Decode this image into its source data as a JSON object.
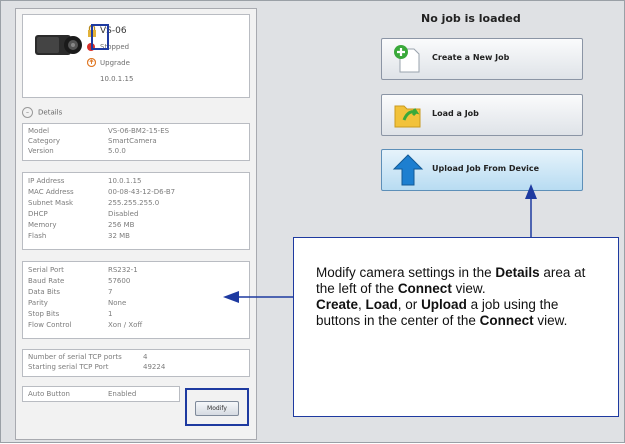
{
  "device": {
    "name": "VS-06",
    "status": "Stopped",
    "upgrade": "Upgrade",
    "ip": "10.0.1.15"
  },
  "details_header": "Details",
  "details": {
    "general": [
      {
        "k": "Model",
        "v": "VS-06-BM2-15-ES"
      },
      {
        "k": "Category",
        "v": "SmartCamera"
      },
      {
        "k": "Version",
        "v": "5.0.0"
      }
    ],
    "network": [
      {
        "k": "IP Address",
        "v": "10.0.1.15"
      },
      {
        "k": "MAC Address",
        "v": "00-08-43-12-D6-B7"
      },
      {
        "k": "Subnet Mask",
        "v": "255.255.255.0"
      },
      {
        "k": "DHCP",
        "v": "Disabled"
      },
      {
        "k": "Memory",
        "v": "256 MB"
      },
      {
        "k": "Flash",
        "v": "32 MB"
      }
    ],
    "serial": [
      {
        "k": "Serial Port",
        "v": "RS232-1"
      },
      {
        "k": "Baud Rate",
        "v": "57600"
      },
      {
        "k": "Data Bits",
        "v": "7"
      },
      {
        "k": "Parity",
        "v": "None"
      },
      {
        "k": "Stop Bits",
        "v": "1"
      },
      {
        "k": "Flow Control",
        "v": "Xon / Xoff"
      }
    ],
    "tcp": [
      {
        "k": "Number of serial TCP ports",
        "v": "4"
      },
      {
        "k": "Starting serial TCP Port",
        "v": "49224"
      }
    ],
    "auto": [
      {
        "k": "Auto Button",
        "v": "Enabled"
      }
    ]
  },
  "modify_label": "Modify",
  "no_job": "No job is loaded",
  "buttons": {
    "create": "Create a New Job",
    "load": "Load a Job",
    "upload": "Upload Job From Device"
  },
  "callout": {
    "l1a": "Modify camera settings in the ",
    "l1b": "Details",
    "l1c": " area at the left of the ",
    "l1d": "Connect",
    "l1e": " view.",
    "l2a": "Create",
    "l2b": ", ",
    "l2c": "Load",
    "l2d": ", or ",
    "l2e": "Upload",
    "l2f": " a job using the buttons in the center of the ",
    "l2g": "Connect",
    "l2h": " view."
  },
  "colors": {
    "accent": "#1e3aa0",
    "stopped": "#d9302a",
    "upgrade": "#e07b2a"
  }
}
